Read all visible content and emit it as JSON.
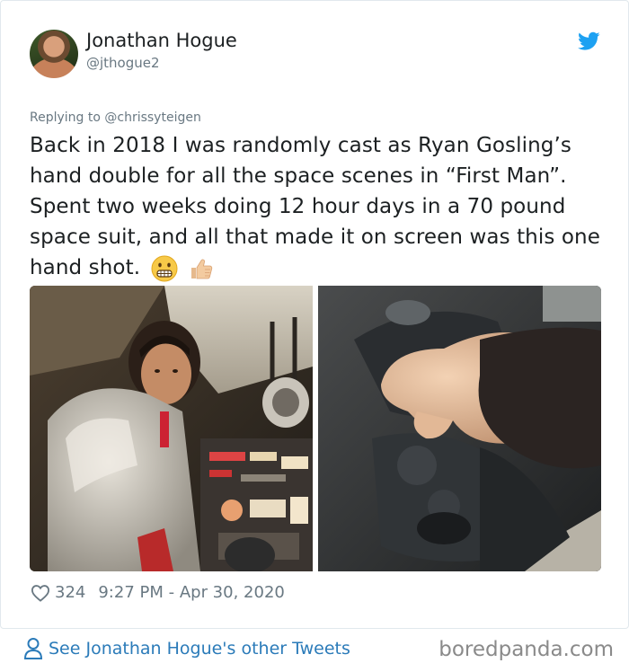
{
  "tweet": {
    "author_name": "Jonathan Hogue",
    "author_handle": "@jthogue2",
    "replying_to": "Replying to @chrissyteigen",
    "text": "Back in 2018 I was randomly cast as Ryan Gosling’s hand double for all the space scenes in “First Man”. Spent two weeks doing 12 hour days in a 70 pound space suit, and all that made it on screen was this one hand shot.",
    "emojis": [
      "grimacing-face-icon",
      "thumbs-up-icon"
    ],
    "likes": "324",
    "timestamp": "9:27 PM - Apr 30, 2020",
    "media": [
      "astronaut-in-cockpit-photo",
      "hand-on-controller-photo"
    ]
  },
  "footer": {
    "see_more": "See Jonathan Hogue's other Tweets",
    "watermark": "boredpanda.com"
  },
  "colors": {
    "link_blue": "#2b7bb9",
    "twitter_blue": "#1da1f2",
    "muted_gray": "#697882",
    "text": "#1c2022"
  }
}
